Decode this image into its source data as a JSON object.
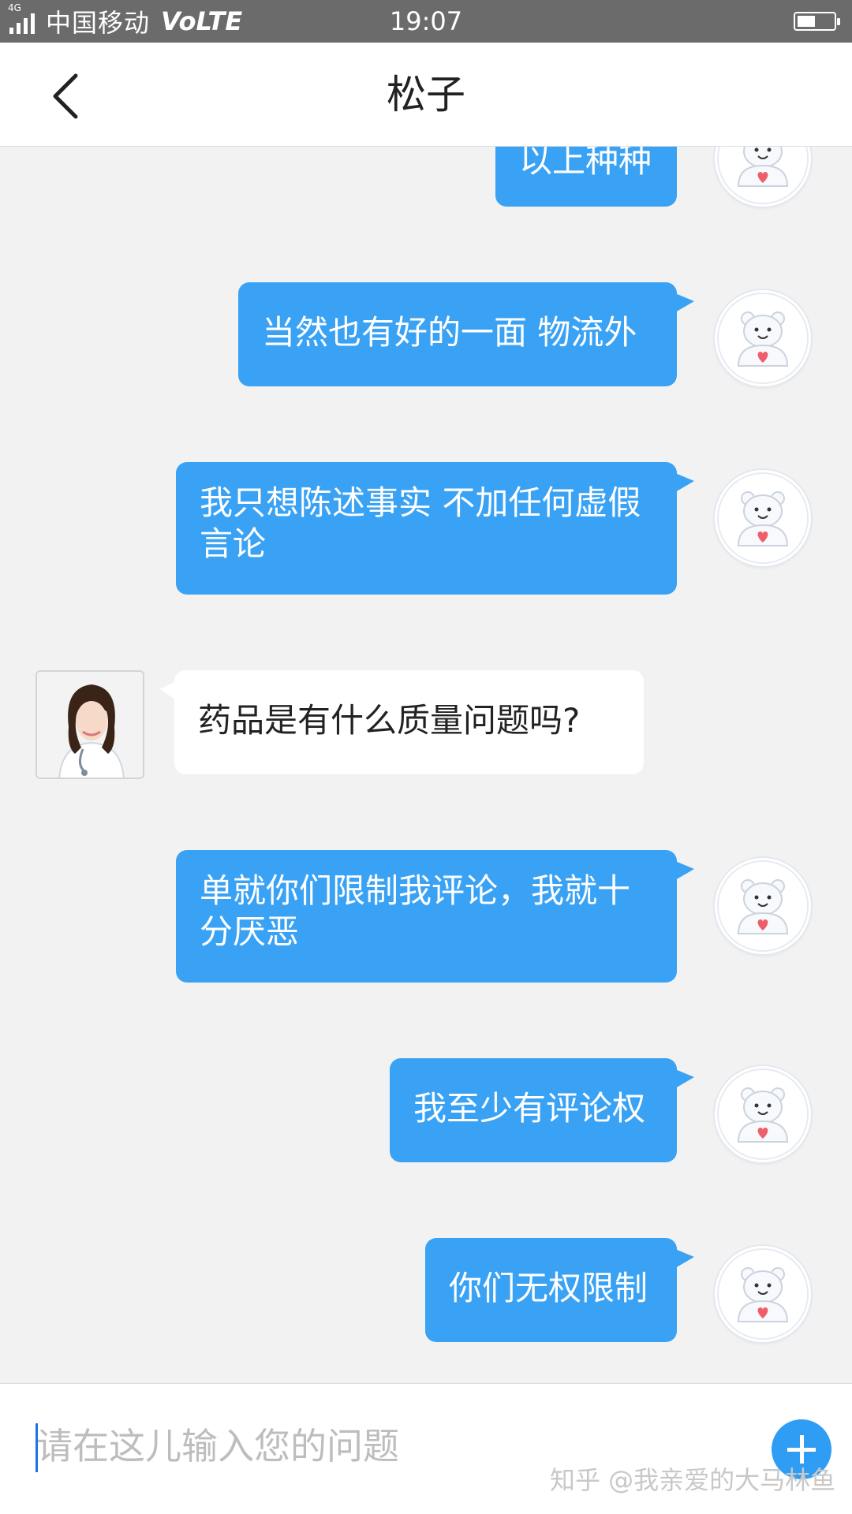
{
  "status_bar": {
    "network": "4G",
    "carrier": "中国移动",
    "volte": "VoLTE",
    "time": "19:07"
  },
  "header": {
    "title": "松子"
  },
  "messages": [
    {
      "sender": "me",
      "text": "以上种种"
    },
    {
      "sender": "me",
      "text": "当然也有好的一面 物流外"
    },
    {
      "sender": "me",
      "text": "我只想陈述事实 不加任何虚假言论"
    },
    {
      "sender": "them",
      "text": "药品是有什么质量问题吗?"
    },
    {
      "sender": "me",
      "text": "单就你们限制我评论，我就十分厌恶"
    },
    {
      "sender": "me",
      "text": "我至少有评论权"
    },
    {
      "sender": "me",
      "text": "你们无权限制"
    }
  ],
  "input": {
    "placeholder": "请在这儿输入您的问题",
    "value": ""
  },
  "watermark": "知乎 @我亲爱的大马林鱼",
  "colors": {
    "my_bubble": "#3aa2f4",
    "their_bubble": "#ffffff",
    "background": "#f2f2f2",
    "accent": "#2f9df4"
  },
  "icons": [
    "back-arrow-icon",
    "plus-icon",
    "bear-avatar-icon",
    "doctor-avatar"
  ]
}
